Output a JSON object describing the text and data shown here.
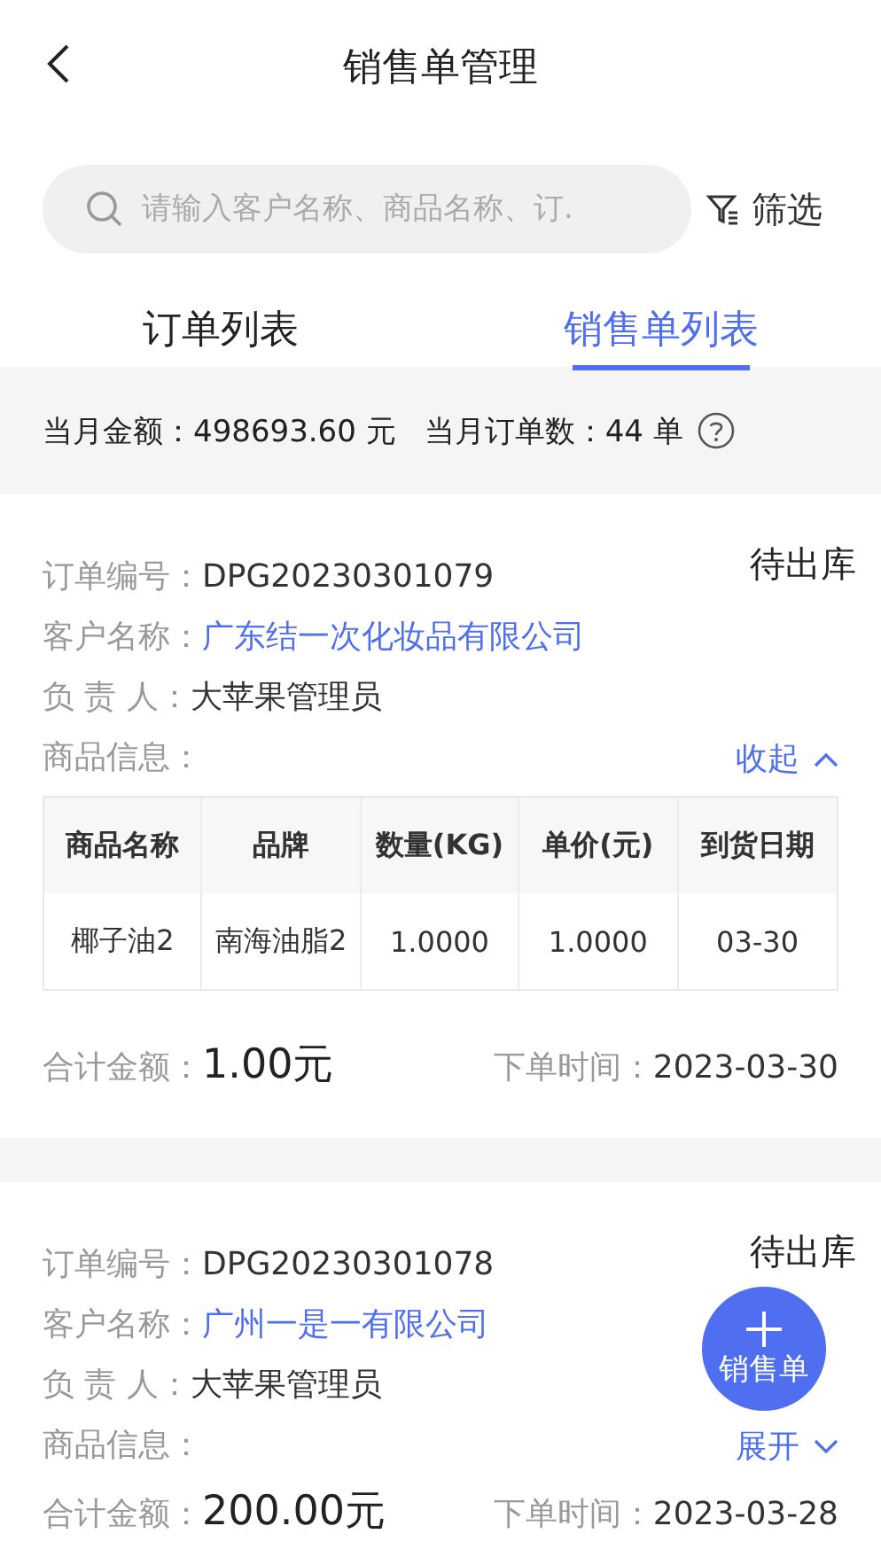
{
  "header": {
    "title": "销售单管理"
  },
  "search": {
    "placeholder": "请输入客户名称、商品名称、订.",
    "filter_label": "筛选"
  },
  "tabs": [
    {
      "label": "订单列表",
      "selected": false
    },
    {
      "label": "销售单列表",
      "selected": true
    }
  ],
  "summary": {
    "month_amount_label": "当月金额：",
    "month_amount": "498693.60 元",
    "month_orders_label": "当月订单数：",
    "month_orders": "44 单"
  },
  "orders": [
    {
      "status": "待出库",
      "order_no_label": "订单编号：",
      "order_no": "DPG20230301079",
      "customer_label": "客户名称：",
      "customer": "广东结一次化妆品有限公司",
      "owner_label": "负 责 人：",
      "owner": "大苹果管理员",
      "goods_label": "商品信息：",
      "toggle_label": "收起",
      "expanded": true,
      "columns": [
        "商品名称",
        "品牌",
        "数量(KG)",
        "单价(元)",
        "到货日期"
      ],
      "items": [
        [
          "椰子油2",
          "南海油脂2",
          "1.0000",
          "1.0000",
          "03-30"
        ]
      ],
      "total_label": "合计金额：",
      "total": "1.00元",
      "time_label": "下单时间：",
      "time": "2023-03-30"
    },
    {
      "status": "待出库",
      "order_no_label": "订单编号：",
      "order_no": "DPG20230301078",
      "customer_label": "客户名称：",
      "customer": "广州一是一有限公司",
      "owner_label": "负 责 人：",
      "owner": "大苹果管理员",
      "goods_label": "商品信息：",
      "toggle_label": "展开",
      "expanded": false,
      "total_label": "合计金额：",
      "total": "200.00元",
      "time_label": "下单时间：",
      "time": "2023-03-28"
    }
  ],
  "fab": {
    "label": "销售单"
  }
}
